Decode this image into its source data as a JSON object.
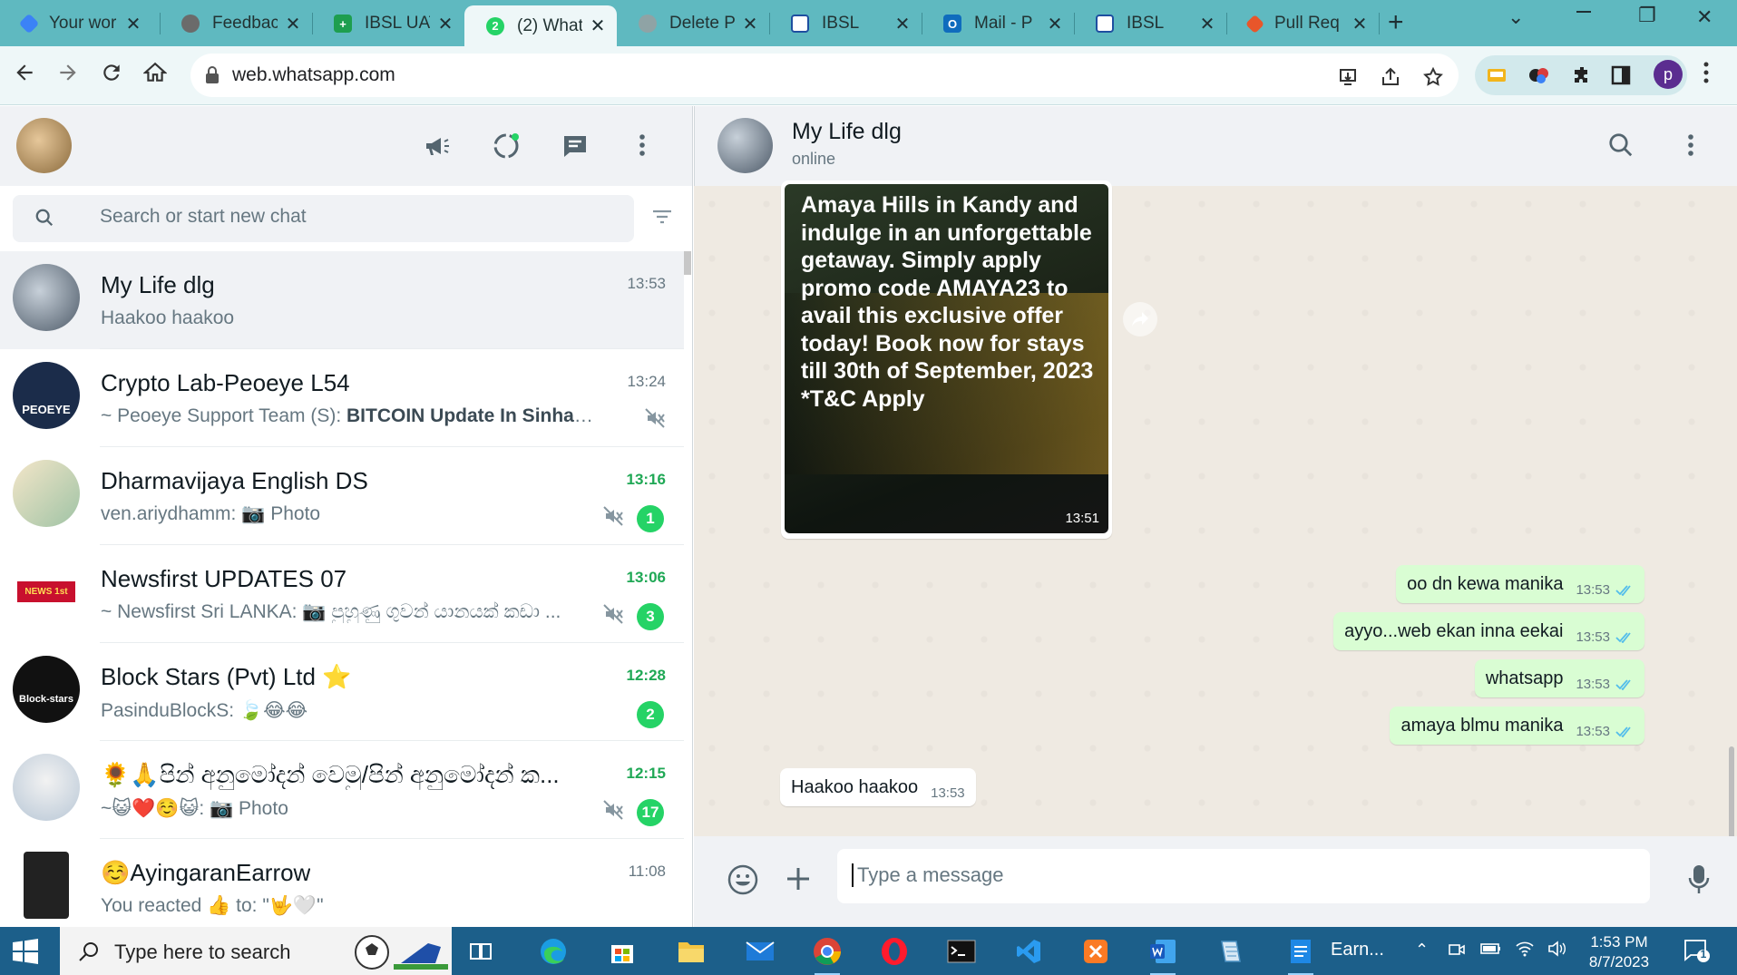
{
  "browser": {
    "tabs": [
      {
        "title": "Your wor",
        "icon_color": "#3b82f6",
        "icon_name": "diamond-icon"
      },
      {
        "title": "Feedback",
        "icon_color": "#555555",
        "icon_name": "globe-icon"
      },
      {
        "title": "IBSL UAT",
        "icon_color": "#1e9e4f",
        "icon_name": "plus-square-icon"
      },
      {
        "title": "(2) What",
        "icon_color": "#25d366",
        "icon_name": "whatsapp-icon",
        "active": true
      },
      {
        "title": "Delete P",
        "icon_color": "#6b7c7e",
        "icon_name": "openai-icon"
      },
      {
        "title": "IBSL",
        "icon_color": "#1e4fa0",
        "icon_name": "ibsl-icon"
      },
      {
        "title": "Mail - P",
        "icon_color": "#0f6cbd",
        "icon_name": "outlook-icon"
      },
      {
        "title": "IBSL",
        "icon_color": "#1e4fa0",
        "icon_name": "ibsl-icon"
      },
      {
        "title": "Pull Req",
        "icon_color": "#e8562a",
        "icon_name": "git-icon"
      }
    ],
    "url": "web.whatsapp.com",
    "profile_initial": "p"
  },
  "left": {
    "search_placeholder": "Search or start new chat",
    "chats": [
      {
        "name": "My Life dlg",
        "time": "13:53",
        "preview_sender": "",
        "preview": "Haakoo haakoo",
        "muted": false,
        "unread": "",
        "selected": true,
        "avatar_color": "#5d6c78"
      },
      {
        "name": "Crypto Lab-Peoeye L54",
        "time": "13:24",
        "preview_sender": "~ Peoeye Support Team (S): ",
        "preview": "BITCOIN Update In Sinhala | BT...",
        "muted": true,
        "unread": "",
        "avatar_color": "#1b2c4a",
        "avatar_label": "PEOEYE"
      },
      {
        "name": "Dharmavijaya English DS",
        "time": "13:16",
        "preview_sender": "ven.ariydhamm: ",
        "preview": "📷 Photo",
        "muted": true,
        "unread": "1",
        "avatar_color": "#c9d9c7"
      },
      {
        "name": "Newsfirst UPDATES 07",
        "time": "13:06",
        "preview_sender": "~ Newsfirst Sri LANKA: ",
        "preview": "📷 පුහුණු ගුවන් යානයක් කඩා ...",
        "muted": true,
        "unread": "3",
        "avatar_color": "#ffffff",
        "avatar_label": "NEWS 1st"
      },
      {
        "name": "Block Stars (Pvt) Ltd ⭐",
        "time": "12:28",
        "preview_sender": "PasinduBlockS: ",
        "preview": "🍃😂😂",
        "muted": false,
        "unread": "2",
        "avatar_color": "#111111",
        "avatar_label": "Block-stars"
      },
      {
        "name": "🌻🙏පින් අනුමෝදන් වෙමු/පින් අනුමෝදන් ක...",
        "time": "12:15",
        "preview_sender": "~😺❤️☺️😺: ",
        "preview": "📷 Photo",
        "muted": true,
        "unread": "17",
        "avatar_color": "#dfe7ef"
      },
      {
        "name": "☺️AyingaranEarrow",
        "time": "11:08",
        "preview_sender": "You reacted 👍 to: ",
        "preview": "\"🤟🤍\"",
        "muted": false,
        "unread": "",
        "avatar_color": "#222222"
      }
    ]
  },
  "right": {
    "contact_name": "My Life dlg",
    "contact_status": "online",
    "image_message": {
      "caption": "Amaya Hills in Kandy and indulge in an unforgettable getaway. Simply apply promo code AMAYA23 to avail this exclusive offer today! Book now for stays till 30th of September, 2023 *T&C Apply",
      "time": "13:51"
    },
    "messages": [
      {
        "dir": "out",
        "text": "oo dn kewa manika",
        "time": "13:53"
      },
      {
        "dir": "out",
        "text": "ayyo...web ekan inna eekai",
        "time": "13:53"
      },
      {
        "dir": "out",
        "text": "whatsapp",
        "time": "13:53"
      },
      {
        "dir": "out",
        "text": "amaya blmu manika",
        "time": "13:53"
      },
      {
        "dir": "in",
        "text": "Haakoo haakoo",
        "time": "13:53"
      }
    ],
    "composer_placeholder": "Type a message"
  },
  "taskbar": {
    "search_text": "Type here to search",
    "word_label": "Earn...",
    "time": "1:53 PM",
    "date": "8/7/2023",
    "notification_count": "1"
  }
}
